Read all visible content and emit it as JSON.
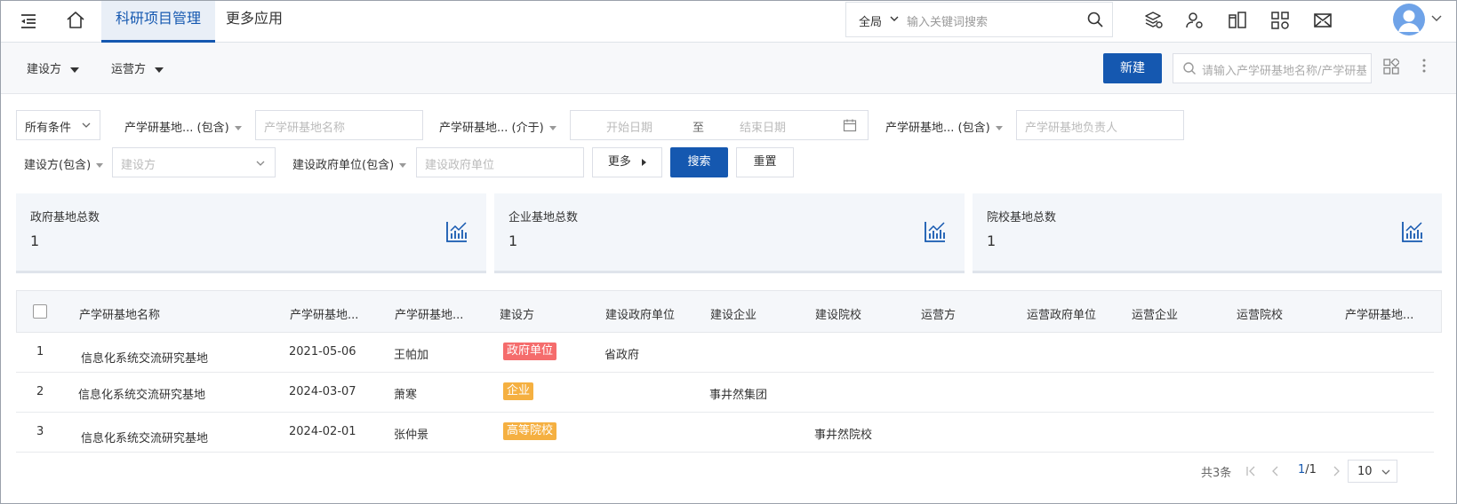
{
  "topbar": {
    "tabs": [
      {
        "label": "科研项目管理",
        "active": true
      },
      {
        "label": "更多应用",
        "active": false
      }
    ],
    "search": {
      "scope": "全局",
      "placeholder": "输入关键词搜索"
    }
  },
  "toolbar": {
    "filters": [
      {
        "label": "建设方"
      },
      {
        "label": "运营方"
      }
    ],
    "new_button": "新建",
    "search_placeholder": "请输入产学研基地名称/产学研基地负责人"
  },
  "conditions": {
    "all_conditions": "所有条件",
    "name_label": "产学研基地... (包含)",
    "name_placeholder": "产学研基地名称",
    "date_label": "产学研基地... (介于)",
    "start_placeholder": "开始日期",
    "date_sep": "至",
    "end_placeholder": "结束日期",
    "leader_label": "产学研基地... (包含)",
    "leader_placeholder": "产学研基地负责人",
    "builder_label": "建设方(包含)",
    "builder_placeholder": "建设方",
    "gov_label": "建设政府单位(包含)",
    "gov_placeholder": "建设政府单位",
    "more_button": "更多",
    "search_button": "搜索",
    "reset_button": "重置"
  },
  "stats": [
    {
      "title": "政府基地总数",
      "value": "1"
    },
    {
      "title": "企业基地总数",
      "value": "1"
    },
    {
      "title": "院校基地总数",
      "value": "1"
    }
  ],
  "table": {
    "headers": [
      "产学研基地名称",
      "产学研基地...",
      "产学研基地...",
      "建设方",
      "建设政府单位",
      "建设企业",
      "建设院校",
      "运营方",
      "运营政府单位",
      "运营企业",
      "运营院校",
      "产学研基地..."
    ],
    "rows": [
      {
        "index": "1",
        "name": "信息化系统交流研究基地",
        "date": "2021-05-06",
        "leader": "王帕加",
        "builder": "政府单位",
        "builder_color": "#f56c6c",
        "gov": "省政府",
        "company": "",
        "school": ""
      },
      {
        "index": "2",
        "name": "信息化系统交流研究基地",
        "date": "2024-03-07",
        "leader": "萧寒",
        "builder": "企业",
        "builder_color": "#f5b041",
        "gov": "",
        "company": "事井然集团",
        "school": ""
      },
      {
        "index": "3",
        "name": "信息化系统交流研究基地",
        "date": "2024-02-01",
        "leader": "张仲景",
        "builder": "高等院校",
        "builder_color": "#f5b041",
        "gov": "",
        "company": "",
        "school": "事井然院校"
      }
    ]
  },
  "pagination": {
    "total": "共3条",
    "current": "1",
    "pages": "/1",
    "page_size": "10"
  },
  "colors": {
    "primary": "#1558b0",
    "gov_tag": "#f56c6c",
    "other_tag": "#f5b041"
  }
}
